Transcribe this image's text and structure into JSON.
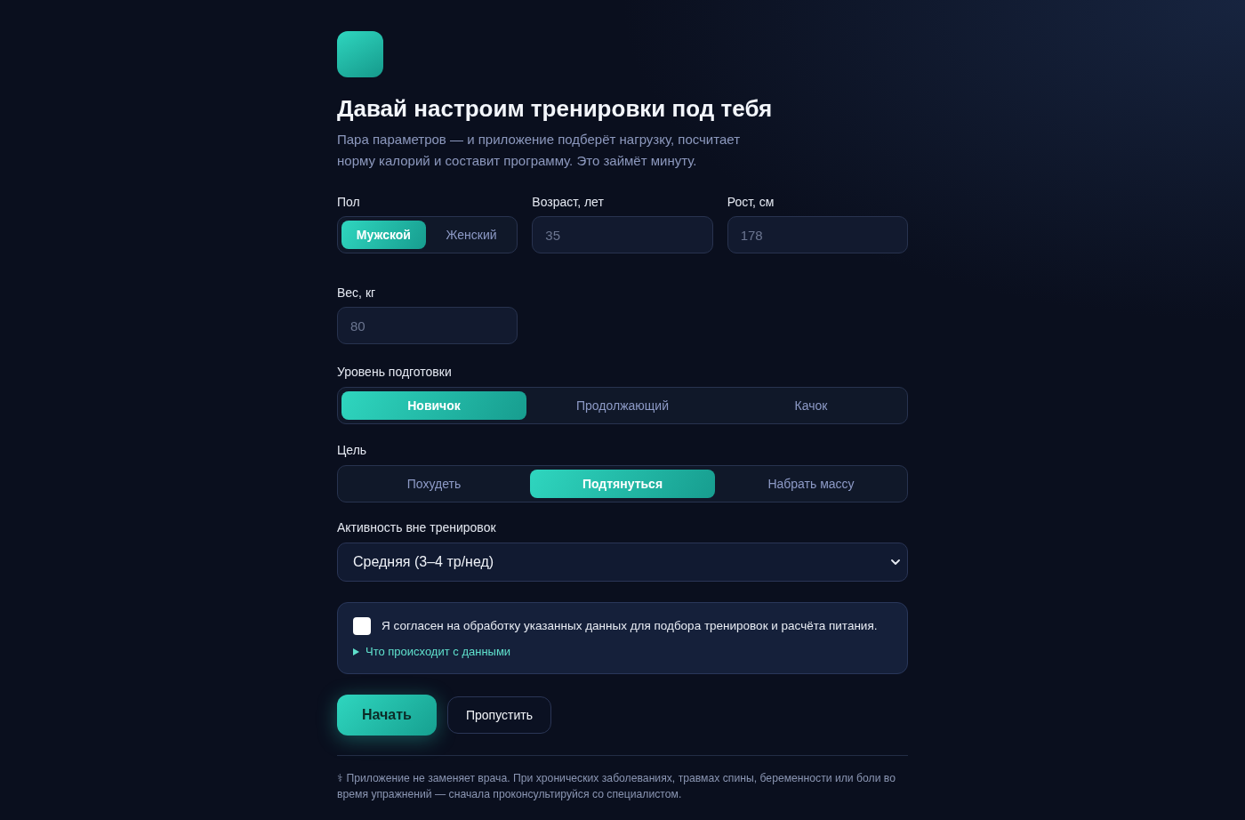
{
  "title": "Давай настроим тренировки под тебя",
  "subtitle": "Пара параметров — и приложение подберёт нагрузку, посчитает норму калорий и составит программу. Это займёт минуту.",
  "fields": [
    {
      "kind": "segmented",
      "label": "Пол",
      "options": [
        {
          "label": "Мужской",
          "selected": true
        },
        {
          "label": "Женский",
          "selected": false
        }
      ]
    },
    {
      "kind": "input",
      "label": "Возраст, лет",
      "placeholder": "35"
    },
    {
      "kind": "input",
      "label": "Рост, см",
      "placeholder": "178"
    },
    {
      "kind": "input",
      "label": "Вес, кг",
      "placeholder": "80"
    }
  ],
  "level": {
    "label": "Уровень подготовки",
    "options": [
      {
        "label": "Новичок",
        "selected": true
      },
      {
        "label": "Продолжающий",
        "selected": false
      },
      {
        "label": "Качок",
        "selected": false
      }
    ]
  },
  "goal": {
    "label": "Цель",
    "options": [
      {
        "label": "Похудеть",
        "selected": false
      },
      {
        "label": "Подтянуться",
        "selected": true
      },
      {
        "label": "Набрать массу",
        "selected": false
      }
    ]
  },
  "activity": {
    "label": "Активность вне тренировок",
    "value": "Средняя (3–4 тр/нед)"
  },
  "consent": {
    "checked": false,
    "text": "Я согласен на обработку указанных данных для подбора тренировок и расчёта питания.",
    "details": {
      "summary": "Что происходит с данными",
      "expanded": false
    }
  },
  "buttons": [
    {
      "kind": "primary",
      "label": "Начать"
    },
    {
      "kind": "secondary",
      "label": "Пропустить"
    }
  ],
  "disclaimer": "⚕ Приложение не заменяет врача. При хронических заболеваниях, травмах спины, беременности или боли во время упражнений — сначала проконсультируйся со специалистом."
}
